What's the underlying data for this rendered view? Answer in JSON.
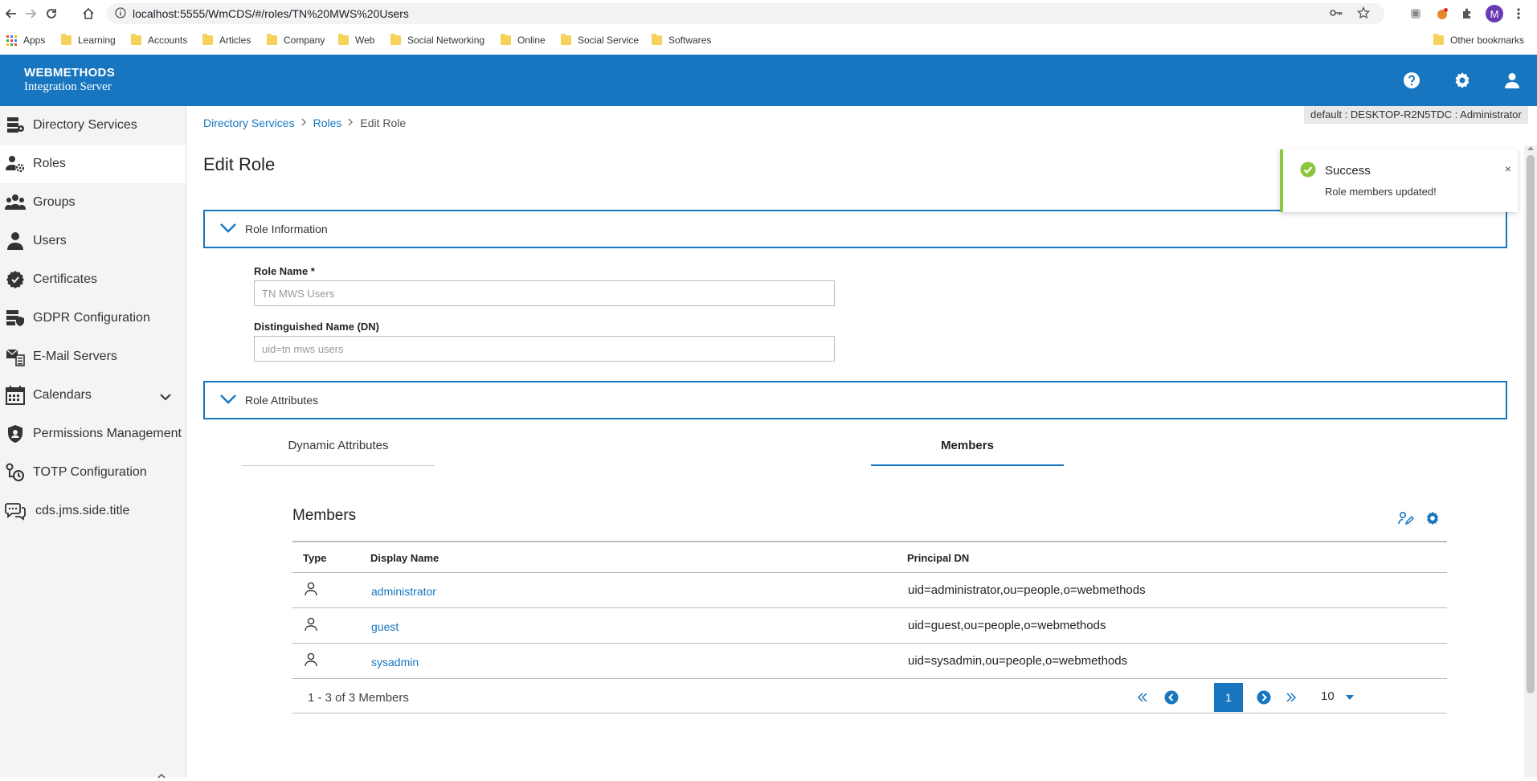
{
  "browser": {
    "url": "localhost:5555/WmCDS/#/roles/TN%20MWS%20Users",
    "profile_initial": "M",
    "bookmarks": [
      "Apps",
      "Learning",
      "Accounts",
      "Articles",
      "Company",
      "Web",
      "Social Networking",
      "Online",
      "Social Service",
      "Softwares"
    ],
    "other_bookmarks": "Other bookmarks"
  },
  "header": {
    "brand_line1": "WEBMETHODS",
    "brand_line2": "Integration Server",
    "accent": "#1776bf"
  },
  "sidebar": {
    "items": [
      {
        "label": "Directory Services",
        "icon": "directory-icon"
      },
      {
        "label": "Roles",
        "icon": "roles-icon"
      },
      {
        "label": "Groups",
        "icon": "groups-icon"
      },
      {
        "label": "Users",
        "icon": "user-icon"
      },
      {
        "label": "Certificates",
        "icon": "certificate-icon"
      },
      {
        "label": "GDPR Configuration",
        "icon": "gdpr-icon"
      },
      {
        "label": "E-Mail Servers",
        "icon": "email-server-icon"
      },
      {
        "label": "Calendars",
        "icon": "calendar-icon"
      },
      {
        "label": "Permissions Management",
        "icon": "shield-icon"
      },
      {
        "label": "TOTP Configuration",
        "icon": "totp-icon"
      },
      {
        "label": "cds.jms.side.title",
        "icon": "chat-icon"
      }
    ],
    "active_index": 1
  },
  "breadcrumb": {
    "items": [
      "Directory Services",
      "Roles"
    ],
    "current": "Edit Role"
  },
  "server_tag": "default : DESKTOP-R2N5TDC : Administrator",
  "page_title": "Edit Role",
  "role_information": {
    "title": "Role Information",
    "role_name_label": "Role Name *",
    "role_name_value": "TN MWS Users",
    "dn_label": "Distinguished Name (DN)",
    "dn_value": "uid=tn mws users"
  },
  "role_attributes": {
    "title": "Role Attributes"
  },
  "tabs": [
    "Dynamic Attributes",
    "Members"
  ],
  "active_tab": 1,
  "members": {
    "title": "Members",
    "columns": [
      "Type",
      "Display Name",
      "Principal DN"
    ],
    "rows": [
      {
        "name": "administrator",
        "dn": "uid=administrator,ou=people,o=webmethods"
      },
      {
        "name": "guest",
        "dn": "uid=guest,ou=people,o=webmethods"
      },
      {
        "name": "sysadmin",
        "dn": "uid=sysadmin,ou=people,o=webmethods"
      }
    ],
    "count_text": "1 - 3 of 3 Members",
    "current_page": "1",
    "page_size": "10"
  },
  "toast": {
    "title": "Success",
    "message": "Role members updated!",
    "close": "×",
    "color": "#8cc63f"
  }
}
